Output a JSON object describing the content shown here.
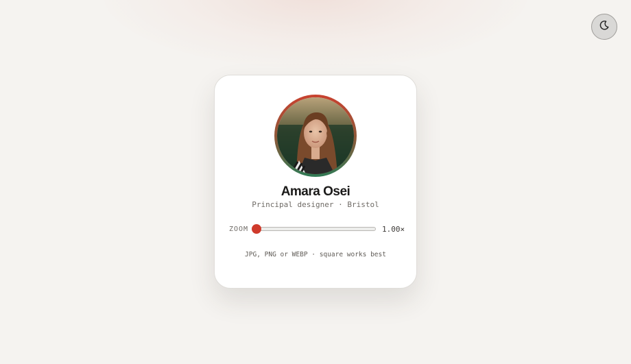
{
  "theme_toggle": {
    "icon": "moon-icon"
  },
  "profile": {
    "name": "Amara Osei",
    "role": "Principal designer · Bristol",
    "avatar_icon": "profile-photo"
  },
  "zoom": {
    "label": "ZOOM",
    "value": 1.0,
    "value_label": "1.00×"
  },
  "upload": {
    "hint": "JPG, PNG or WEBP · square works best"
  },
  "colors": {
    "accent": "#cf3a2b",
    "ring_start": "#c9412f",
    "ring_end": "#2f7a55",
    "background": "#f5f3f0",
    "card": "#ffffff"
  }
}
